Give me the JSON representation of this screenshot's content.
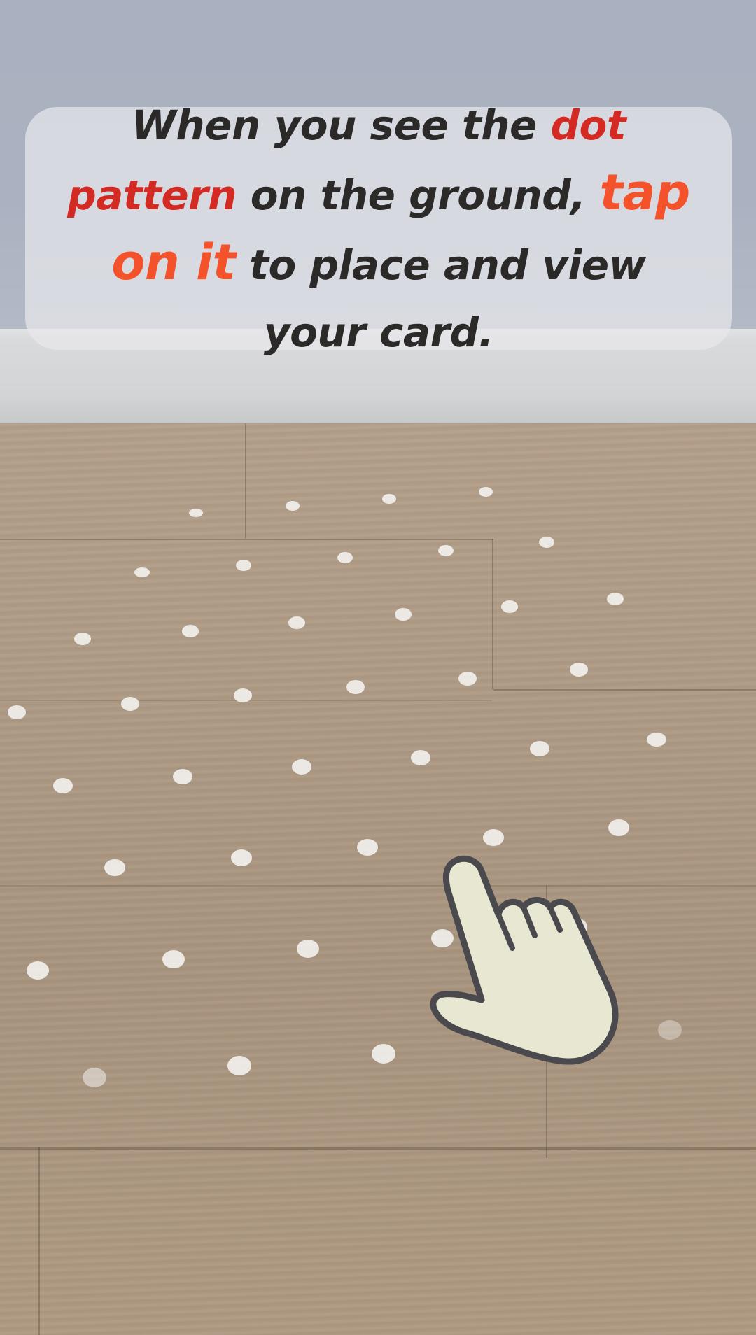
{
  "instruction": {
    "part1": "When you see the ",
    "highlight_pattern": "dot pattern",
    "part2": " on the ground, ",
    "highlight_tap": "tap on it",
    "part3": " to place and view your card."
  },
  "colors": {
    "text": "#2b2a28",
    "pattern_highlight": "#d42a24",
    "tap_highlight": "#f4522a",
    "hand_fill": "#e8e8d2",
    "hand_outline": "#4a4a4e"
  },
  "icons": {
    "hand": "tap-hand-icon"
  }
}
